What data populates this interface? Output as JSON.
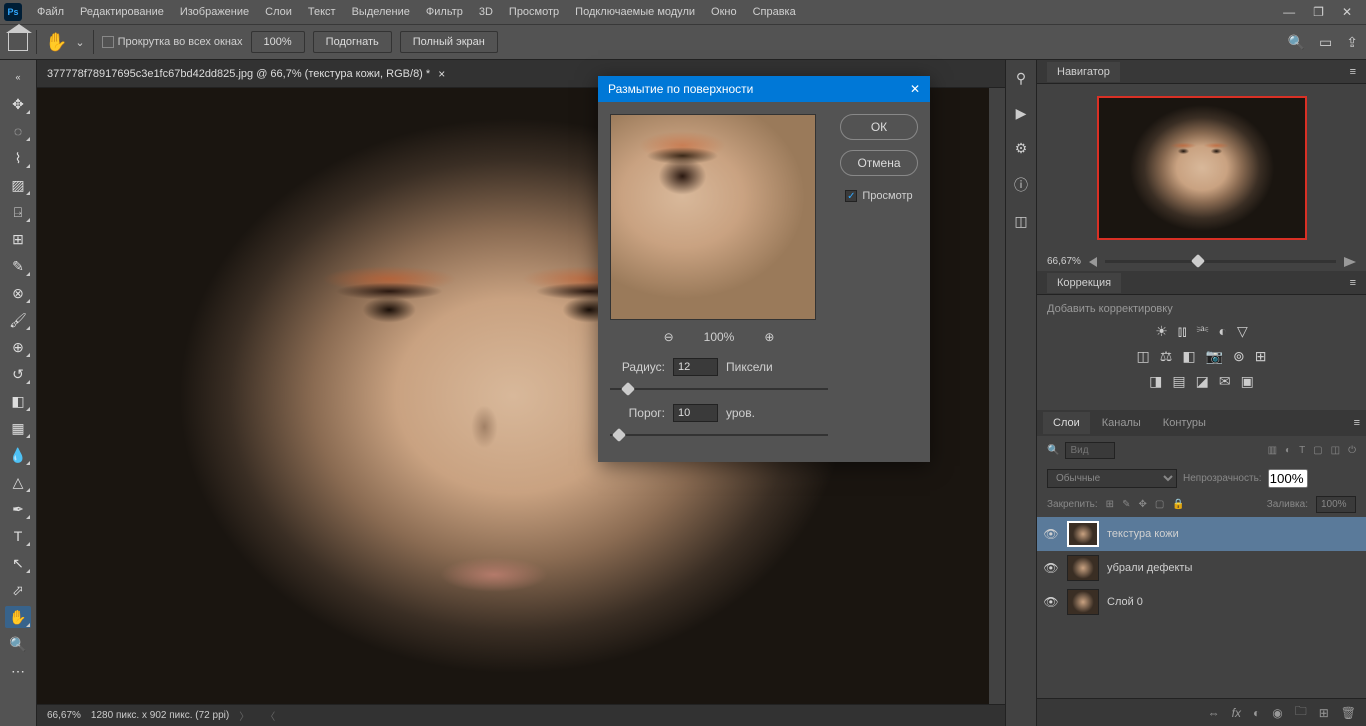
{
  "menus": [
    "Файл",
    "Редактирование",
    "Изображение",
    "Слои",
    "Текст",
    "Выделение",
    "Фильтр",
    "3D",
    "Просмотр",
    "Подключаемые модули",
    "Окно",
    "Справка"
  ],
  "optbar": {
    "scroll_all": "Прокрутка во всех окнах",
    "zoom": "100%",
    "fit": "Подогнать",
    "full": "Полный экран"
  },
  "doc_tab": "377778f78917695c3e1fc67bd42dd825.jpg @ 66,7% (текстура кожи, RGB/8) *",
  "status": {
    "zoom": "66,67%",
    "dims": "1280 пикс. x 902 пикс. (72 ppi)"
  },
  "dialog": {
    "title": "Размытие по поверхности",
    "ok": "ОК",
    "cancel": "Отмена",
    "preview": "Просмотр",
    "zoom_pct": "100%",
    "radius_lbl": "Радиус:",
    "radius_val": "12",
    "radius_unit": "Пиксели",
    "thresh_lbl": "Порог:",
    "thresh_val": "10",
    "thresh_unit": "уров."
  },
  "panels": {
    "navigator": "Навигатор",
    "nav_zoom": "66,67%",
    "adjustments": "Коррекция",
    "adj_hint": "Добавить корректировку",
    "layers_tab": "Слои",
    "channels_tab": "Каналы",
    "paths_tab": "Контуры",
    "search_ph": "Вид",
    "blend": "Обычные",
    "opacity_lbl": "Непрозрачность:",
    "opacity_val": "100%",
    "lock_lbl": "Закрепить:",
    "fill_lbl": "Заливка:",
    "fill_val": "100%"
  },
  "layers": [
    {
      "name": "текстура кожи",
      "sel": true
    },
    {
      "name": "убрали дефекты",
      "sel": false
    },
    {
      "name": "Слой 0",
      "sel": false
    }
  ]
}
